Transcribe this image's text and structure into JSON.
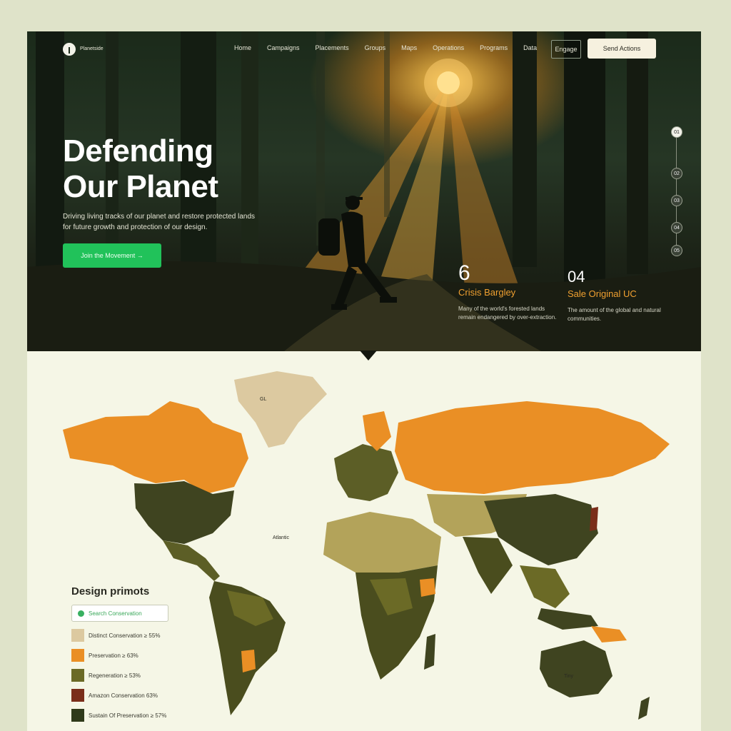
{
  "nav": {
    "logo_text": "Planetside",
    "links": [
      "Home",
      "Campaigns",
      "Placements",
      "Groups",
      "Maps",
      "Operations",
      "Programs",
      "Data"
    ],
    "engage_label": "Engage",
    "cta_label": "Send Actions"
  },
  "hero": {
    "title_line1": "Defending",
    "title_line2": "Our Planet",
    "subtitle": "Driving living tracks of our planet and restore protected lands for future growth and protection of our design.",
    "cta_label": "Join the Movement  →",
    "side_dots": [
      "01",
      "02",
      "03",
      "04",
      "05"
    ],
    "stats": [
      {
        "number": "6",
        "label": "Crisis Bargley",
        "desc": "Many of the world's forested lands remain endangered by over-extraction."
      },
      {
        "number": "04",
        "label": "Sale Original UC",
        "desc": "The amount of the global and natural communities."
      }
    ]
  },
  "map": {
    "label_greenland": "GL",
    "label_atlantic": "Atlantic",
    "label_australia": "Tiny",
    "colors": {
      "tan": "#d8c79a",
      "orange": "#ea8f25",
      "olive": "#7e7a30",
      "olive_light": "#b3a35a",
      "dark": "#3f4420",
      "red": "#7a2e1a"
    }
  },
  "legend": {
    "title": "Design primots",
    "search_label": "Search Conservation",
    "items": [
      {
        "label": "Distinct Conservation ≥ 55%",
        "color": "#dcc9a0"
      },
      {
        "label": "Preservation ≥ 63%",
        "color": "#ea8f25"
      },
      {
        "label": "Regeneration ≥ 53%",
        "color": "#6b6a26"
      },
      {
        "label": "Amazon Conservation 63%",
        "color": "#7a2e1a"
      },
      {
        "label": "Sustain Of Preservation ≥ 57%",
        "color": "#2f3a1a"
      }
    ]
  }
}
